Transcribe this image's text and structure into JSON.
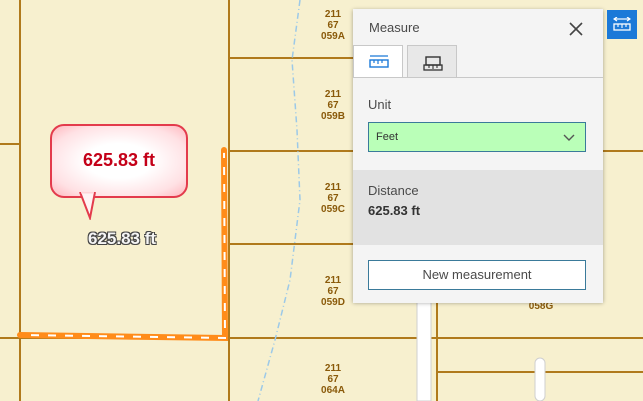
{
  "map": {
    "parcels": [
      {
        "line1": "211",
        "line2": "67",
        "line3": "059A"
      },
      {
        "line1": "211",
        "line2": "67",
        "line3": "059B"
      },
      {
        "line1": "211",
        "line2": "67",
        "line3": "059C"
      },
      {
        "line1": "211",
        "line2": "67",
        "line3": "059D"
      },
      {
        "line1": "211",
        "line2": "67",
        "line3": "064A"
      },
      {
        "line1": "",
        "line2": "",
        "line3": "058G"
      }
    ],
    "callout_text": "625.83 ft",
    "distance_label": "625.83 ft",
    "measure_line_color": "#ff8c1a",
    "parcel_line_color": "#b07a1c",
    "background_color": "#f7f0cf"
  },
  "measure_panel": {
    "title": "Measure",
    "tabs": [
      {
        "icon": "ruler-distance-icon",
        "active": true
      },
      {
        "icon": "ruler-area-icon",
        "active": false
      }
    ],
    "unit_label": "Unit",
    "unit_value": "Feet",
    "distance_label": "Distance",
    "distance_value": "625.83 ft",
    "new_measurement_label": "New measurement"
  },
  "toolbar": {
    "measure_button_icon": "measure-ruler-icon",
    "accent_color": "#1b79d8"
  }
}
